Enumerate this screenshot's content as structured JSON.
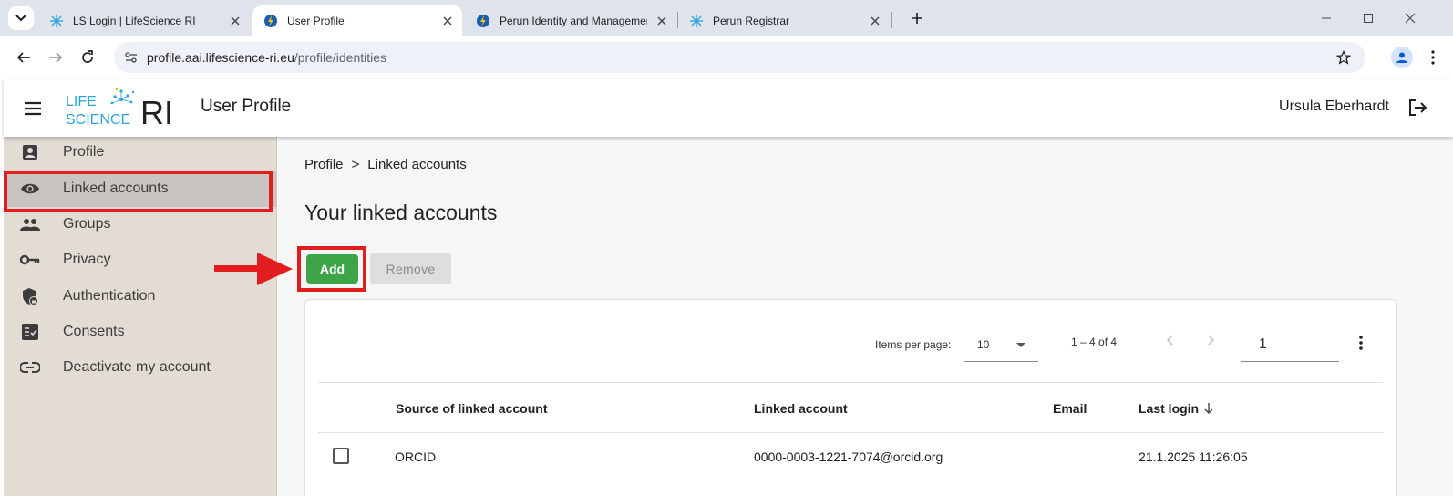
{
  "browser": {
    "tabs": [
      {
        "title": "LS Login | LifeScience RI",
        "active": false
      },
      {
        "title": "User Profile",
        "active": true
      },
      {
        "title": "Perun Identity and Managemen",
        "active": false
      },
      {
        "title": "Perun Registrar",
        "active": false
      }
    ],
    "url_host": "profile.aai.lifescience-ri.eu",
    "url_path": "/profile/identities"
  },
  "app": {
    "logo_line1": "LIFE",
    "logo_line2": "SCIENCE",
    "logo_ri": "RI",
    "title": "User Profile",
    "user_name": "Ursula Eberhardt"
  },
  "sidebar": {
    "items": [
      {
        "label": "Profile",
        "icon": "account-box-icon"
      },
      {
        "label": "Linked accounts",
        "icon": "eye-icon",
        "active": true
      },
      {
        "label": "Groups",
        "icon": "group-icon"
      },
      {
        "label": "Privacy",
        "icon": "key-icon"
      },
      {
        "label": "Authentication",
        "icon": "shield-lock-icon"
      },
      {
        "label": "Consents",
        "icon": "checklist-icon"
      },
      {
        "label": "Deactivate my account",
        "icon": "link-icon"
      }
    ]
  },
  "main": {
    "breadcrumb": [
      "Profile",
      ">",
      "Linked accounts"
    ],
    "title": "Your linked accounts",
    "add_label": "Add",
    "remove_label": "Remove",
    "paginator": {
      "items_per_page_label": "Items per page:",
      "items_per_page": "10",
      "range": "1 – 4 of 4",
      "page": "1"
    },
    "table": {
      "columns": [
        "Source of linked account",
        "Linked account",
        "Email",
        "Last login"
      ],
      "rows": [
        {
          "source": "ORCID",
          "account": "0000-0003-1221-7074@orcid.org",
          "email": "",
          "last_login": "21.1.2025 11:26:05"
        }
      ]
    }
  },
  "colors": {
    "accent_green": "#3da548",
    "highlight_red": "#e11d1d",
    "sidebar_bg": "#e3dcd5",
    "logo_blue": "#2aa6d6"
  }
}
